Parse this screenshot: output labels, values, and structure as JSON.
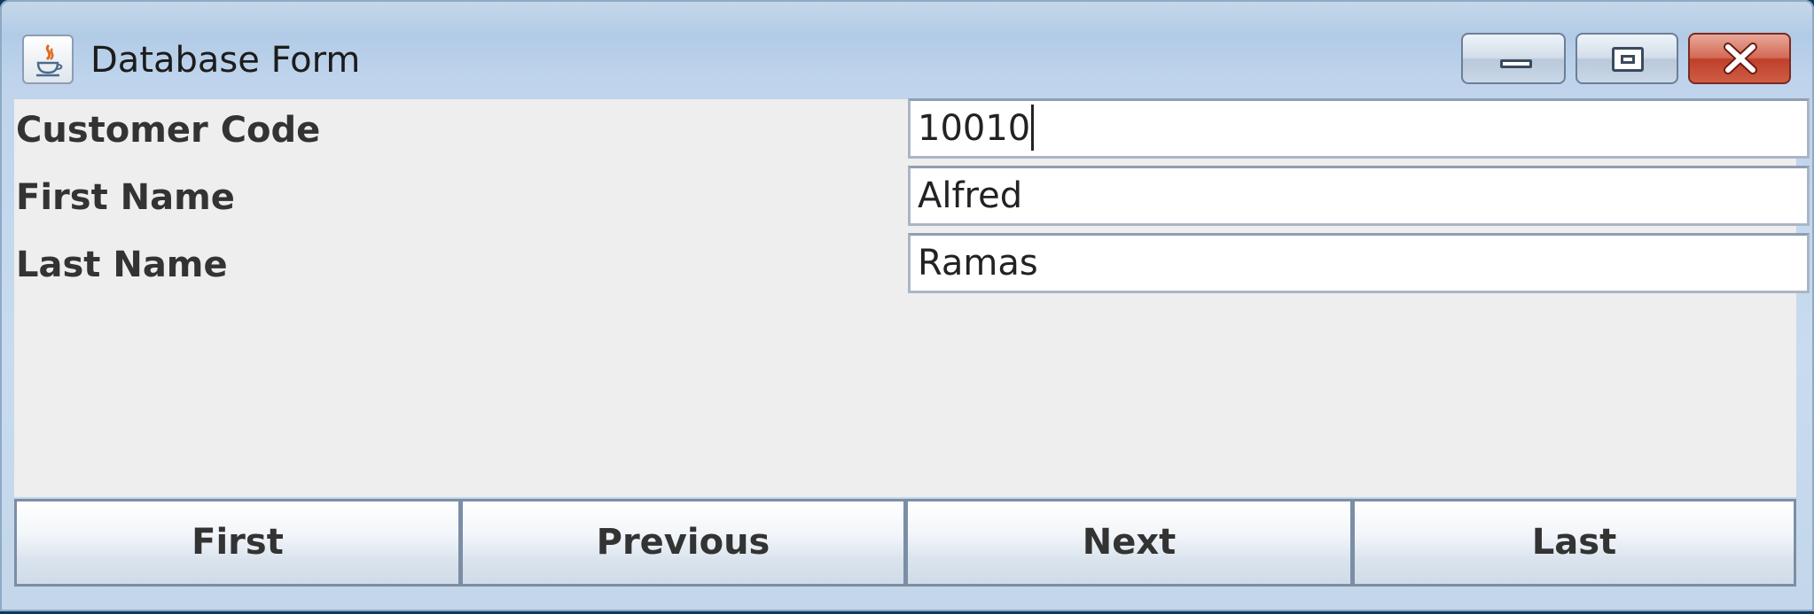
{
  "window": {
    "title": "Database Form",
    "app_icon": "java-cup-icon",
    "controls": {
      "minimize": "minimize-icon",
      "maximize": "maximize-icon",
      "close": "close-icon"
    }
  },
  "form": {
    "fields": [
      {
        "label": "Customer Code",
        "value": "10010"
      },
      {
        "label": "First Name",
        "value": "Alfred"
      },
      {
        "label": "Last Name",
        "value": "Ramas"
      }
    ]
  },
  "navigation": {
    "first": "First",
    "previous": "Previous",
    "next": "Next",
    "last": "Last"
  },
  "colors": {
    "close_button": "#c9493a",
    "panel_background": "#eeeeee",
    "frame": "#c3d6ea"
  }
}
